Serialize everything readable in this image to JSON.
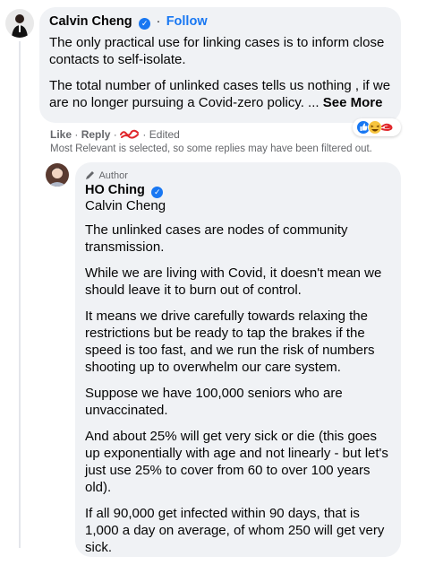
{
  "comment": {
    "author": "Calvin Cheng",
    "follow_label": "Follow",
    "paragraphs": [
      "The only practical use for linking cases is to inform close contacts to self-isolate.",
      "The total number of unlinked cases tells us nothing , if we are no longer pursuing a Covid-zero policy. ..."
    ],
    "see_more": "See More",
    "actions": {
      "like": "Like",
      "reply": "Reply",
      "edited": "Edited",
      "separator": "·"
    }
  },
  "filter_notice": "Most Relevant is selected, so some replies may have been filtered out.",
  "reply": {
    "badge": "Author",
    "author": "HO Ching",
    "mention": "Calvin Cheng",
    "paragraphs": [
      "The unlinked cases are nodes of community transmission.",
      "While we are living with Covid, it doesn't mean we should leave it to burn out of control.",
      "It means we drive carefully towards relaxing the restrictions but be ready to tap the brakes if the speed is too fast, and we run the risk of numbers shooting up to overwhelm our care system.",
      "Suppose we have 100,000 seniors who are unvaccinated.",
      "And about 25% will get very sick or die (this goes up exponentially with age and not linearly - but let's just use 25% to cover from 60 to over 100 years old).",
      "If all 90,000 get infected within 90 days, that is 1,000 a day on average, of whom 250 will get very sick."
    ]
  },
  "colors": {
    "accent": "#1877f2",
    "bubble": "#f0f2f5",
    "meta_text": "#65676b",
    "redaction": "#e0262b"
  },
  "icons": [
    "verified-badge-icon",
    "pencil-icon",
    "like-reaction-icon",
    "haha-reaction-icon",
    "avatar-icon"
  ]
}
